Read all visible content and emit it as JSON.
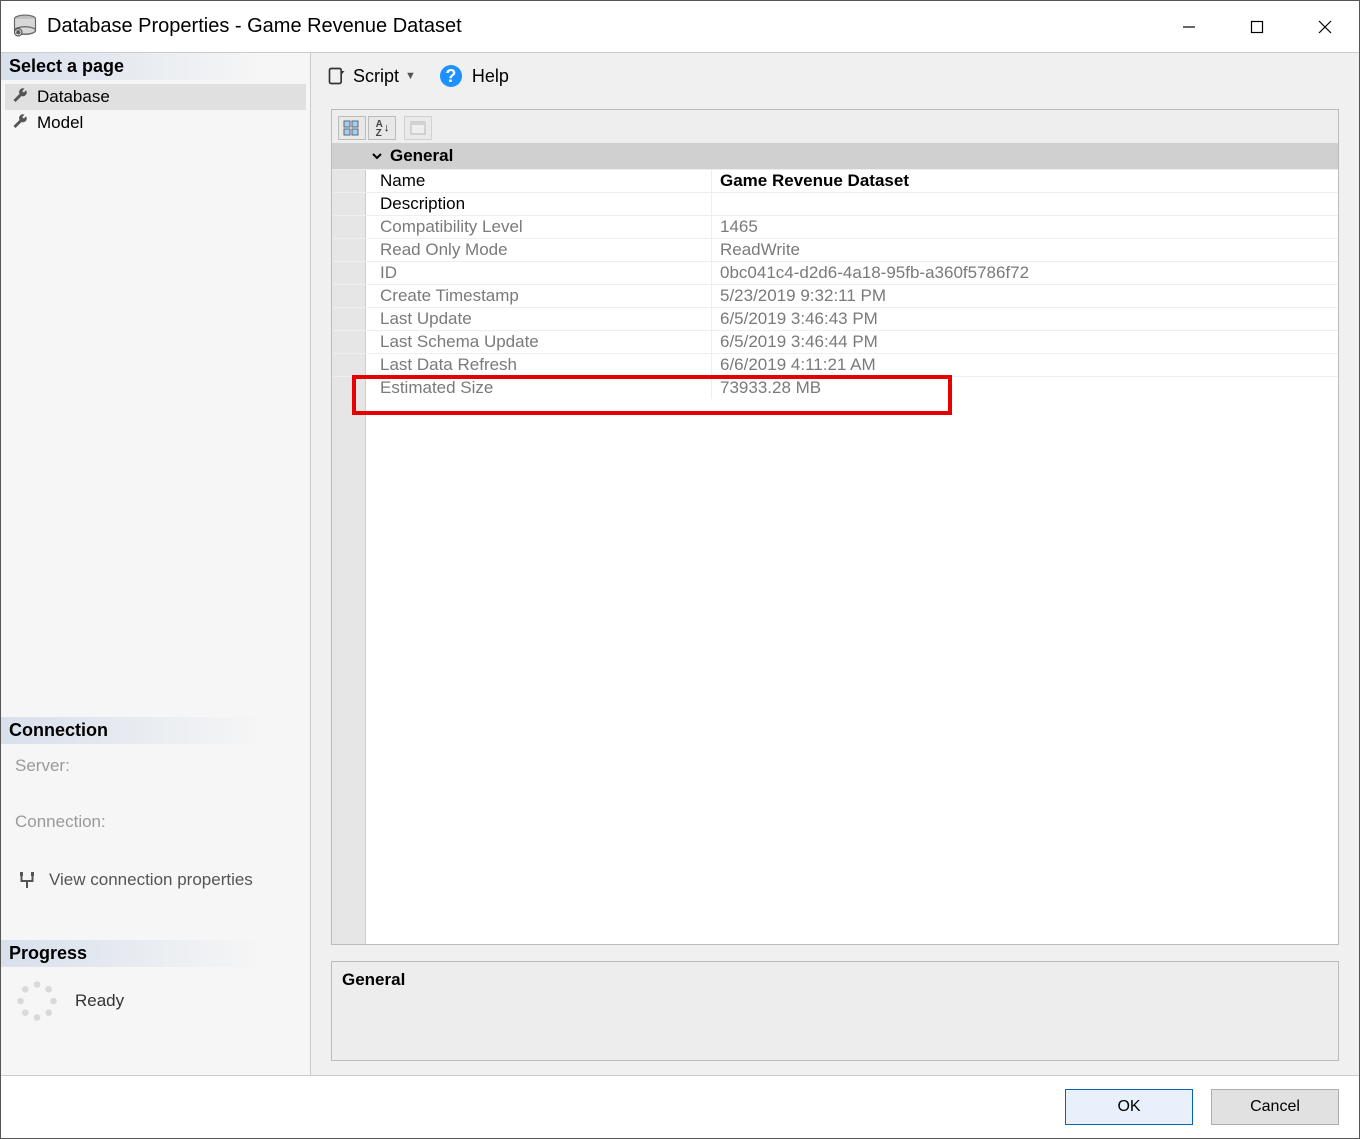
{
  "titlebar": {
    "title": "Database Properties - Game Revenue Dataset"
  },
  "left": {
    "select_page": "Select a page",
    "pages": [
      {
        "label": "Database",
        "selected": true
      },
      {
        "label": "Model",
        "selected": false
      }
    ],
    "connection_header": "Connection",
    "server_label": "Server:",
    "connection_label": "Connection:",
    "view_connection": "View connection properties",
    "progress_header": "Progress",
    "progress_status": "Ready"
  },
  "toolbar": {
    "script_label": "Script",
    "help_label": "Help"
  },
  "grid": {
    "category": "General",
    "rows": [
      {
        "label": "Name",
        "value": "Game Revenue Dataset",
        "readonly": false
      },
      {
        "label": "Description",
        "value": "",
        "readonly": false
      },
      {
        "label": "Compatibility Level",
        "value": "1465",
        "readonly": true
      },
      {
        "label": "Read Only Mode",
        "value": "ReadWrite",
        "readonly": true
      },
      {
        "label": "ID",
        "value": "0bc041c4-d2d6-4a18-95fb-a360f5786f72",
        "readonly": true
      },
      {
        "label": "Create Timestamp",
        "value": "5/23/2019 9:32:11 PM",
        "readonly": true
      },
      {
        "label": "Last Update",
        "value": "6/5/2019 3:46:43 PM",
        "readonly": true
      },
      {
        "label": "Last Schema Update",
        "value": "6/5/2019 3:46:44 PM",
        "readonly": true
      },
      {
        "label": "Last Data Refresh",
        "value": "6/6/2019 4:11:21 AM",
        "readonly": true
      },
      {
        "label": "Estimated Size",
        "value": "73933.28 MB",
        "readonly": true
      }
    ],
    "description_header": "General"
  },
  "footer": {
    "ok": "OK",
    "cancel": "Cancel"
  }
}
